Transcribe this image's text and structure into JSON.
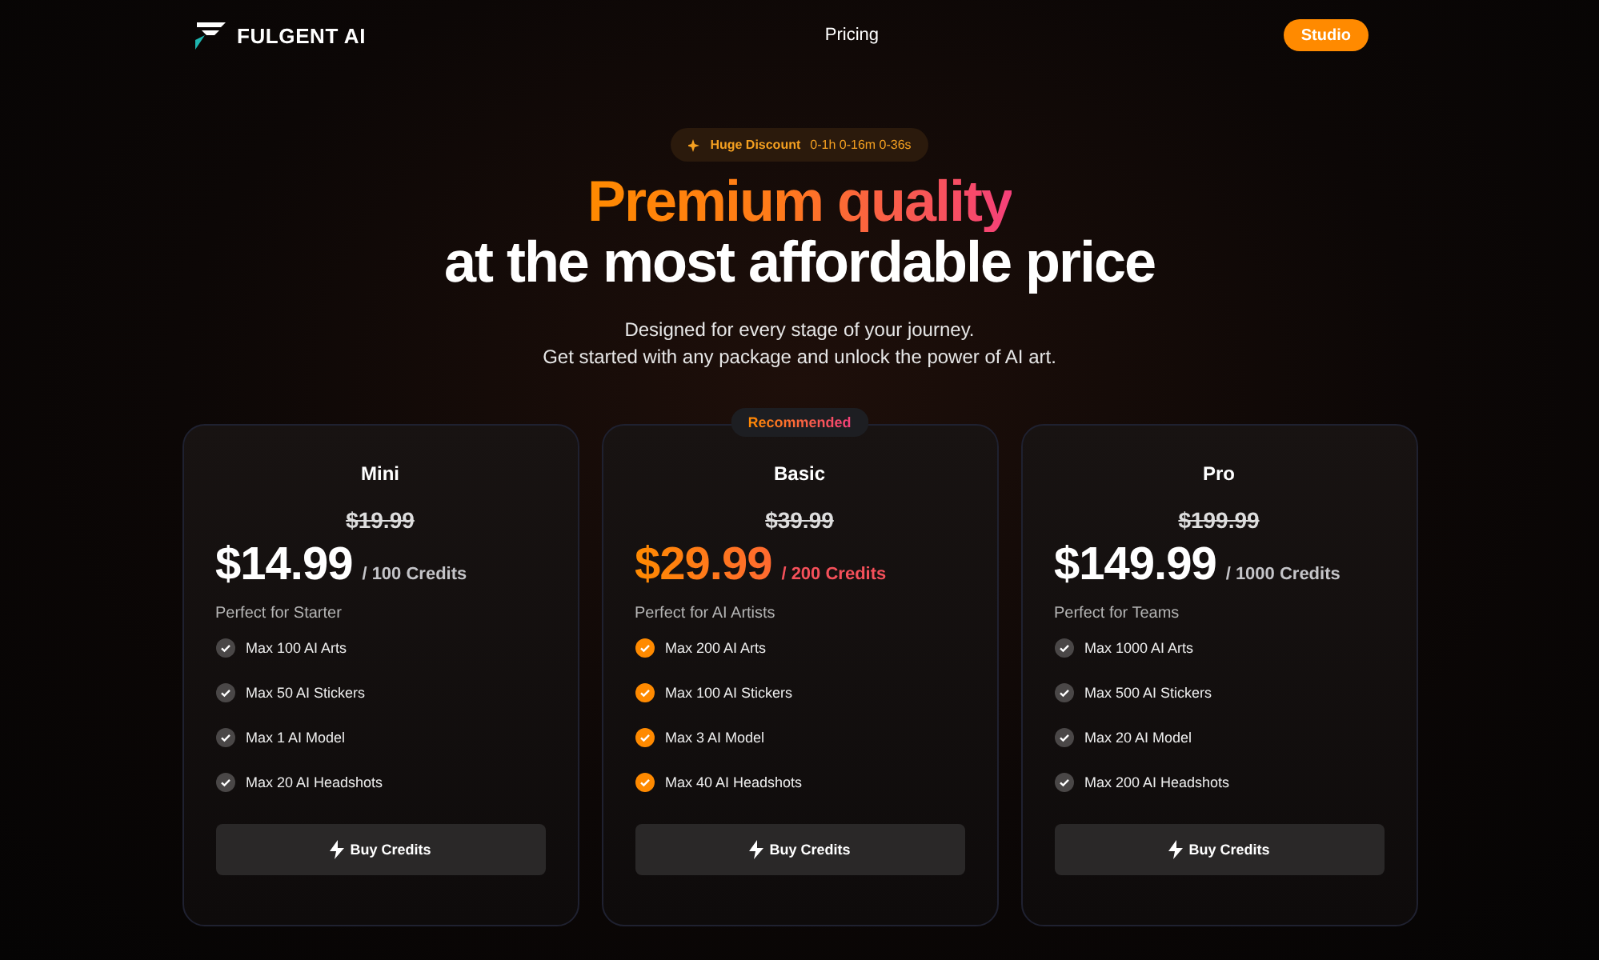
{
  "nav": {
    "brand": "FULGENT AI",
    "links": [
      {
        "label": "Pricing"
      }
    ],
    "action": "Studio"
  },
  "discount": {
    "label": "Huge Discount",
    "countdown": "0-1h 0-16m 0-36s"
  },
  "headline": {
    "line1": "Premium quality",
    "line2": "at the most affordable price"
  },
  "subtitle": [
    "Designed for every stage of your journey.",
    "Get started with any package and unlock the power of AI art."
  ],
  "plans": [
    {
      "name": "Mini",
      "old_price": "$19.99",
      "price": "$14.99",
      "credits": "/ 100 Credits",
      "tagline": "Perfect for Starter",
      "featured": false,
      "features": [
        "Max 100 AI Arts",
        "Max 50 AI Stickers",
        "Max 1 AI Model",
        "Max 20 AI Headshots"
      ],
      "button": "Buy Credits"
    },
    {
      "name": "Basic",
      "badge": "Recommended",
      "old_price": "$39.99",
      "price": "$29.99",
      "credits": "/ 200 Credits",
      "tagline": "Perfect for AI Artists",
      "featured": true,
      "features": [
        "Max 200 AI Arts",
        "Max 100 AI Stickers",
        "Max 3 AI Model",
        "Max 40 AI Headshots"
      ],
      "button": "Buy Credits"
    },
    {
      "name": "Pro",
      "old_price": "$199.99",
      "price": "$149.99",
      "credits": "/ 1000 Credits",
      "tagline": "Perfect for Teams",
      "featured": false,
      "features": [
        "Max 1000 AI Arts",
        "Max 500 AI Stickers",
        "Max 20 AI Model",
        "Max 200 AI Headshots"
      ],
      "button": "Buy Credits"
    }
  ]
}
